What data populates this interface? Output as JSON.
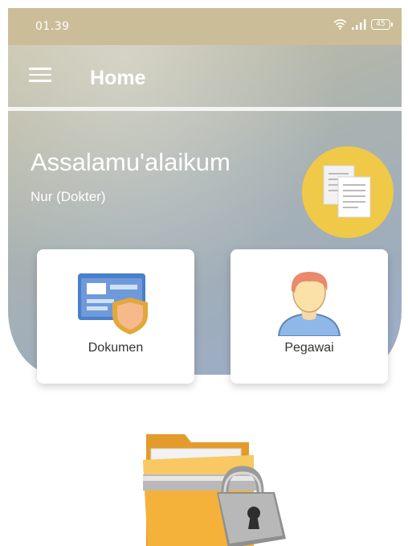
{
  "status_bar": {
    "time": "01.39",
    "battery": "45",
    "icons": [
      "wifi-icon",
      "signal-icon",
      "battery-icon"
    ]
  },
  "app_bar": {
    "title": "Home",
    "menu_icon": "hamburger-menu-icon"
  },
  "header": {
    "greeting": "Assalamu'alaikum",
    "user": "Nur (Dokter)",
    "badge_icon": "documents-icon"
  },
  "menu_cards": [
    {
      "label": "Dokumen",
      "icon": "id-card-shield-icon"
    },
    {
      "label": "Pegawai",
      "icon": "user-person-icon"
    }
  ],
  "illustration": "locked-folder-icon",
  "colors": {
    "accent_yellow": "#efc947",
    "hero_top": "#c6c1a9",
    "hero_bottom": "#9caecb",
    "card_bg": "#ffffff"
  }
}
